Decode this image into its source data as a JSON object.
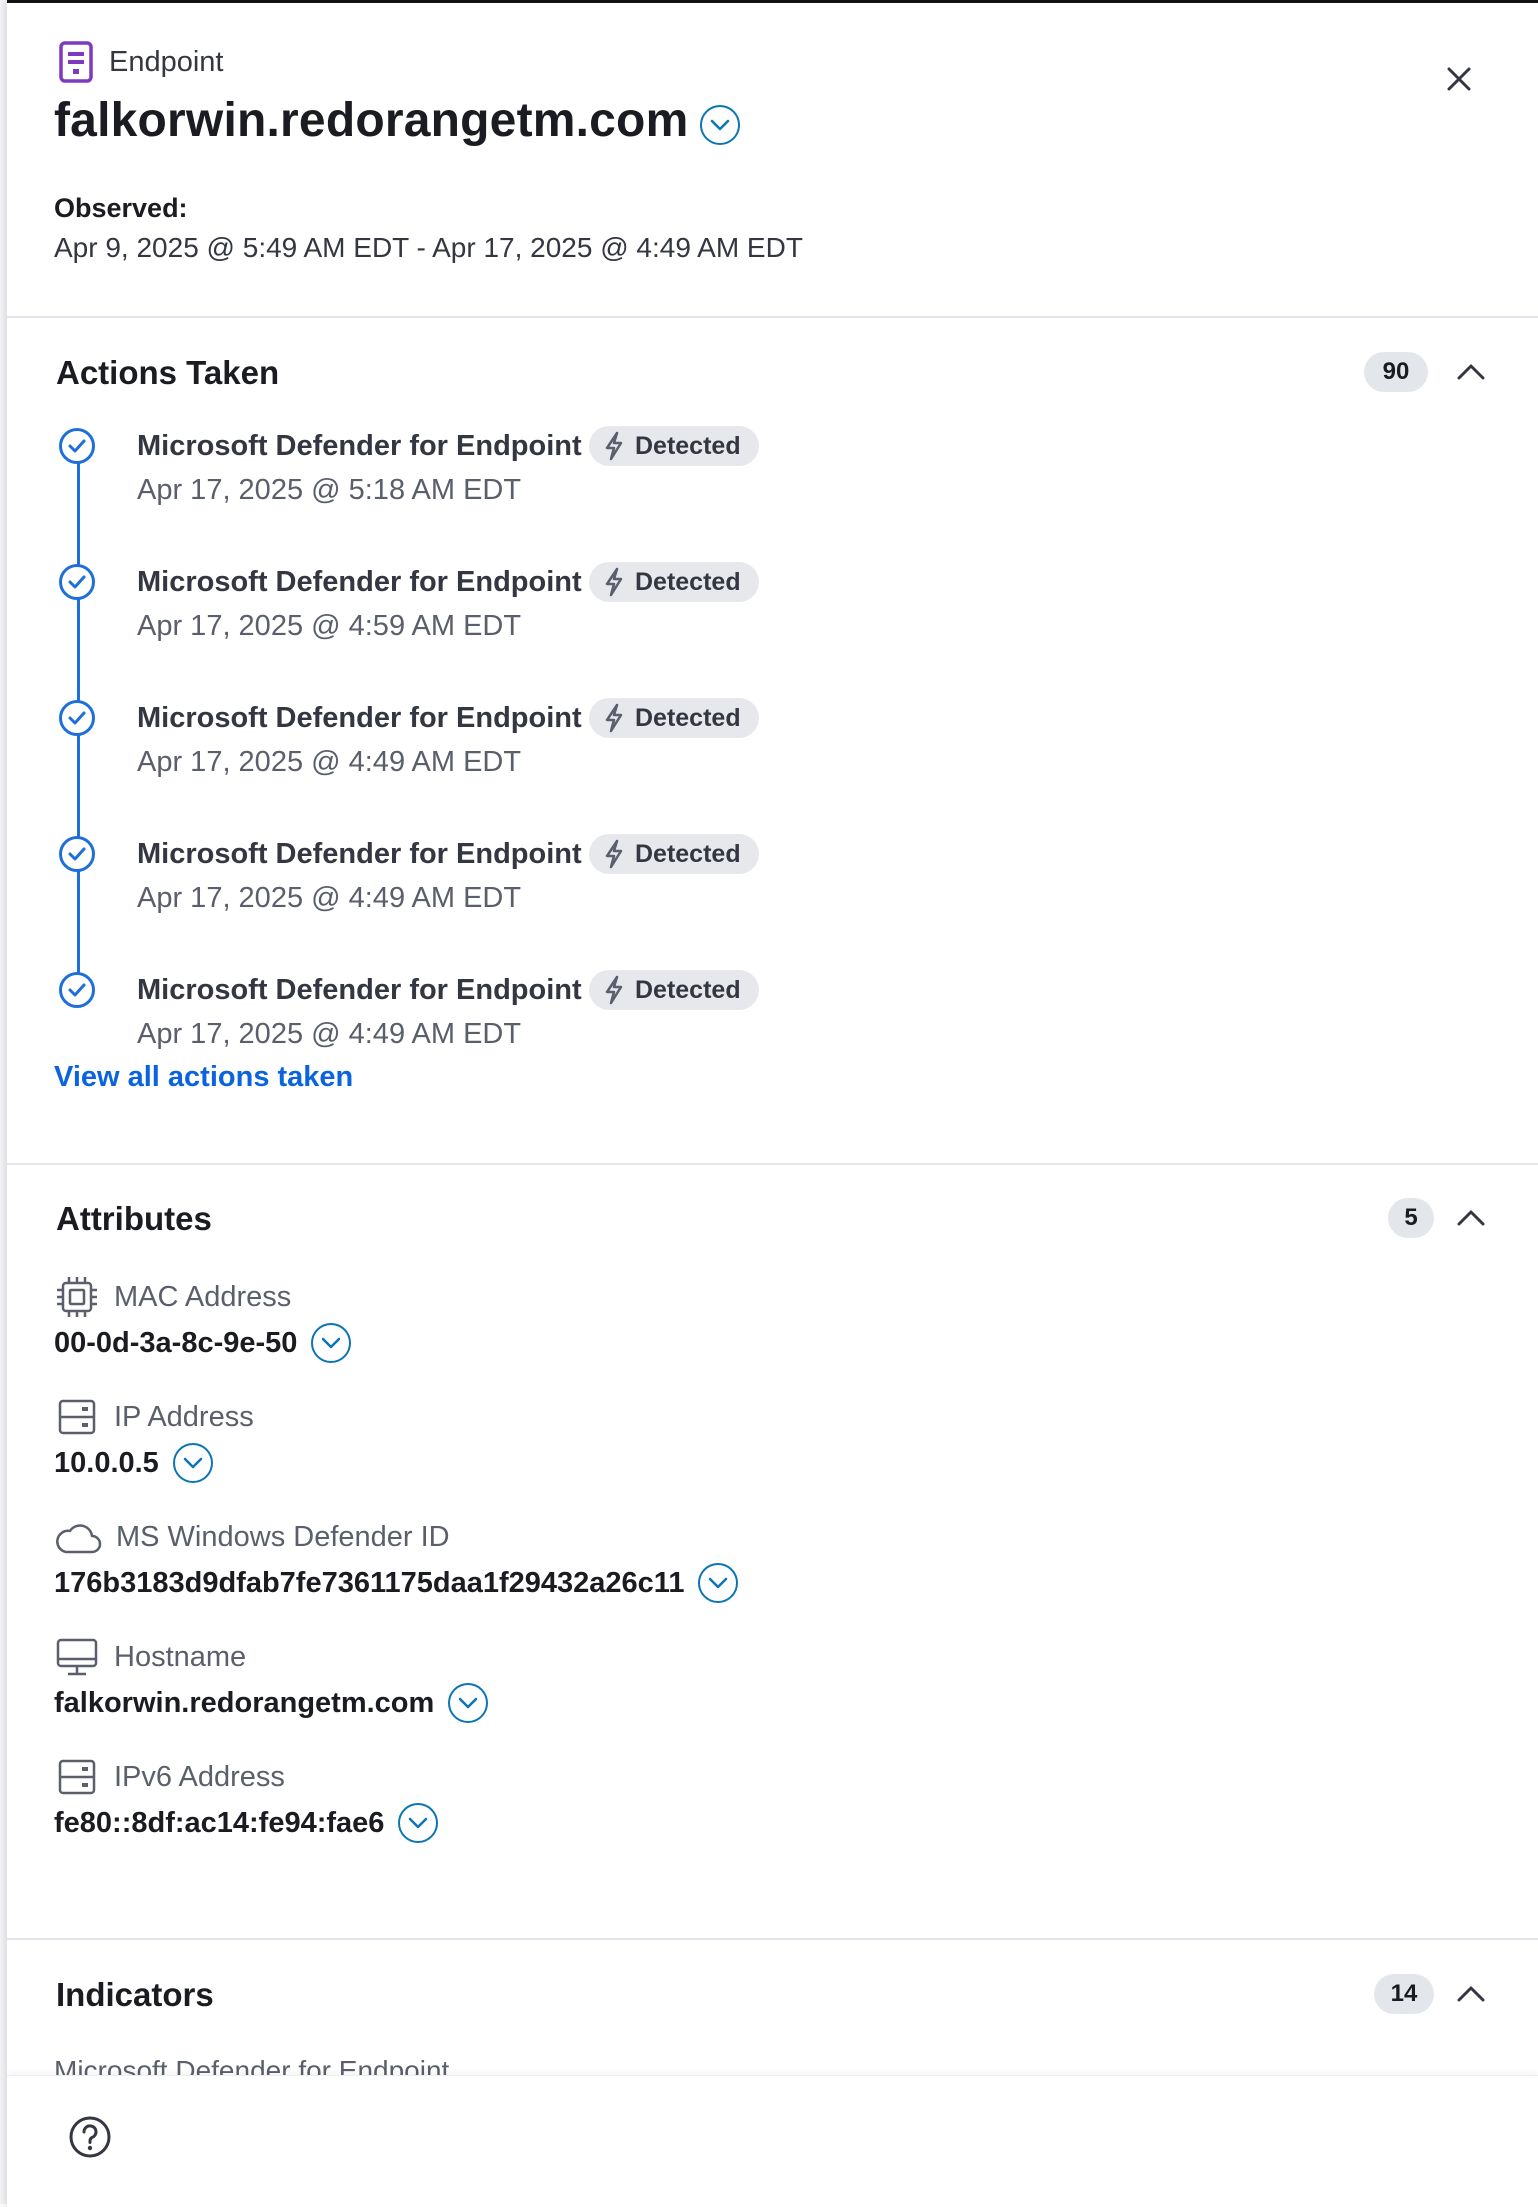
{
  "header": {
    "type_icon": "document-icon",
    "type_label": "Endpoint",
    "title": "falkorwin.redorangetm.com",
    "observed_label": "Observed:",
    "observed_value": "Apr 9, 2025 @ 5:49 AM EDT - Apr 17, 2025 @ 4:49 AM EDT"
  },
  "actions": {
    "title": "Actions Taken",
    "count": "90",
    "items": [
      {
        "source": "Microsoft Defender for Endpoint",
        "status": "Detected",
        "time": "Apr 17, 2025 @ 5:18 AM EDT"
      },
      {
        "source": "Microsoft Defender for Endpoint",
        "status": "Detected",
        "time": "Apr 17, 2025 @ 4:59 AM EDT"
      },
      {
        "source": "Microsoft Defender for Endpoint",
        "status": "Detected",
        "time": "Apr 17, 2025 @ 4:49 AM EDT"
      },
      {
        "source": "Microsoft Defender for Endpoint",
        "status": "Detected",
        "time": "Apr 17, 2025 @ 4:49 AM EDT"
      },
      {
        "source": "Microsoft Defender for Endpoint",
        "status": "Detected",
        "time": "Apr 17, 2025 @ 4:49 AM EDT"
      }
    ],
    "view_all": "View all actions taken"
  },
  "attributes": {
    "title": "Attributes",
    "count": "5",
    "items": [
      {
        "icon": "chip-icon",
        "label": "MAC Address",
        "value": "00-0d-3a-8c-9e-50"
      },
      {
        "icon": "server-icon",
        "label": "IP Address",
        "value": "10.0.0.5"
      },
      {
        "icon": "cloud-icon",
        "label": "MS Windows Defender ID",
        "value": "176b3183d9dfab7fe7361175daa1f29432a26c11"
      },
      {
        "icon": "monitor-icon",
        "label": "Hostname",
        "value": "falkorwin.redorangetm.com"
      },
      {
        "icon": "server-icon",
        "label": "IPv6 Address",
        "value": "fe80::8df:ac14:fe94:fae6"
      }
    ]
  },
  "indicators": {
    "title": "Indicators",
    "count": "14",
    "first_item": "Microsoft Defender for Endpoint"
  },
  "colors": {
    "accent": "#1e6fd9",
    "link": "#0b64dd",
    "type_icon": "#7d3ac1",
    "badge_bg": "#e3e6ea"
  }
}
